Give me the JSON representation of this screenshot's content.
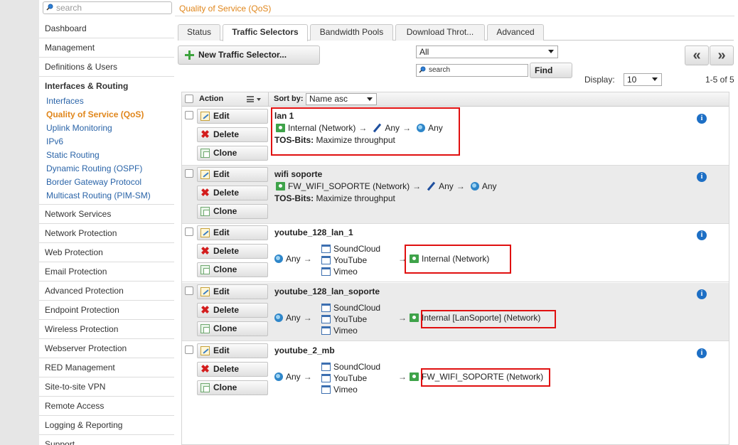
{
  "sidebar": {
    "search_placeholder": "search",
    "items_top": [
      "Dashboard",
      "Management",
      "Definitions & Users"
    ],
    "open_section": "Interfaces & Routing",
    "subitems": [
      "Interfaces",
      "Quality of Service (QoS)",
      "Uplink Monitoring",
      "IPv6",
      "Static Routing",
      "Dynamic Routing (OSPF)",
      "Border Gateway Protocol",
      "Multicast Routing (PIM-SM)"
    ],
    "items_bottom": [
      "Network Services",
      "Network Protection",
      "Web Protection",
      "Email Protection",
      "Advanced Protection",
      "Endpoint Protection",
      "Wireless Protection",
      "Webserver Protection",
      "RED Management",
      "Site-to-site VPN",
      "Remote Access",
      "Logging & Reporting",
      "Support"
    ]
  },
  "header": {
    "title": "Quality of Service (QoS)"
  },
  "tabs": [
    "Status",
    "Traffic Selectors",
    "Bandwidth Pools",
    "Download Throt...",
    "Advanced"
  ],
  "toolbar": {
    "new_label": "New Traffic Selector...",
    "filter_value": "All",
    "search_placeholder": "search",
    "find_label": "Find",
    "prev_label": "«",
    "next_label": "»",
    "display_label": "Display:",
    "display_value": "10",
    "range": "1-5 of 5"
  },
  "table": {
    "col_action": "Action",
    "sort_label": "Sort by:",
    "sort_value": "Name asc",
    "btn_edit": "Edit",
    "btn_delete": "Delete",
    "btn_clone": "Clone",
    "info": "i",
    "arrow": "→",
    "rows": [
      {
        "name": "lan 1",
        "src": "Internal (Network)",
        "svc": "Any",
        "dst": "Any",
        "tos_label": "TOS-Bits:",
        "tos_value": "Maximize throughput"
      },
      {
        "name": "wifi soporte",
        "src": "FW_WIFI_SOPORTE (Network)",
        "svc": "Any",
        "dst": "Any",
        "tos_label": "TOS-Bits:",
        "tos_value": "Maximize throughput"
      },
      {
        "name": "youtube_128_lan_1",
        "src": "Any",
        "apps": [
          "SoundCloud",
          "YouTube",
          "Vimeo"
        ],
        "dst": "Internal (Network)"
      },
      {
        "name": "youtube_128_lan_soporte",
        "src": "Any",
        "apps": [
          "SoundCloud",
          "YouTube",
          "Vimeo"
        ],
        "dst": "Internal [LanSoporte] (Network)"
      },
      {
        "name": "youtube_2_mb",
        "src": "Any",
        "apps": [
          "SoundCloud",
          "YouTube",
          "Vimeo"
        ],
        "dst": "FW_WIFI_SOPORTE (Network)"
      }
    ]
  }
}
